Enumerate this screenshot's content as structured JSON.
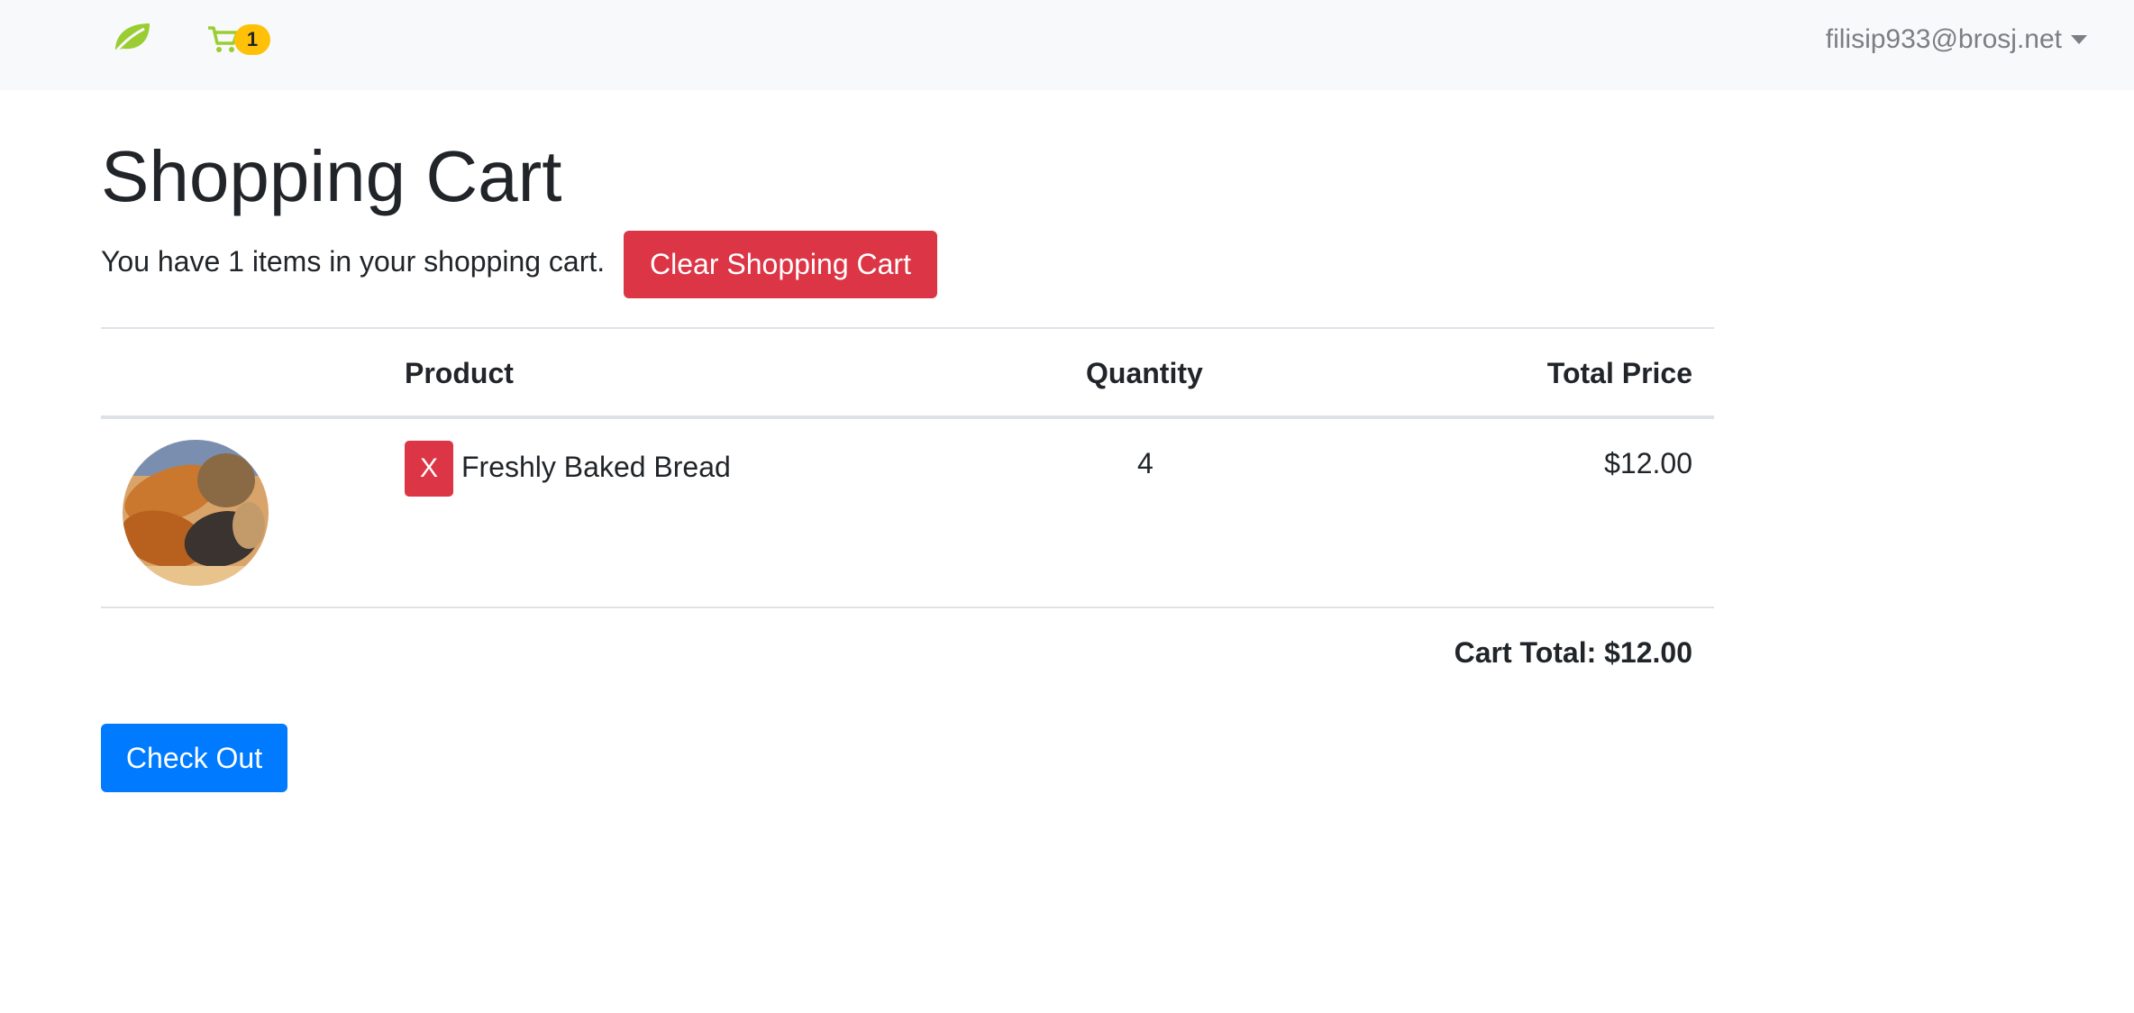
{
  "navbar": {
    "brand_icon": "leaf-icon",
    "cart_icon": "shopping-cart-icon",
    "cart_count": "1",
    "user_email": "filisip933@brosj.net",
    "colors": {
      "brand": "#9acd32",
      "badge": "#ffc107"
    }
  },
  "page": {
    "title": "Shopping Cart",
    "summary": "You have 1 items in your shopping cart.",
    "clear_button": "Clear Shopping Cart"
  },
  "table": {
    "headers": [
      "",
      "Product",
      "Quantity",
      "Total Price"
    ],
    "rows": [
      {
        "image": "bread-photo",
        "remove_label": "X",
        "product": "Freshly Baked Bread",
        "quantity": "4",
        "total_price": "$12.00"
      }
    ],
    "cart_total": "Cart Total: $12.00"
  },
  "actions": {
    "checkout_button": "Check Out"
  },
  "colors": {
    "danger": "#dc3545",
    "primary": "#007bff"
  }
}
